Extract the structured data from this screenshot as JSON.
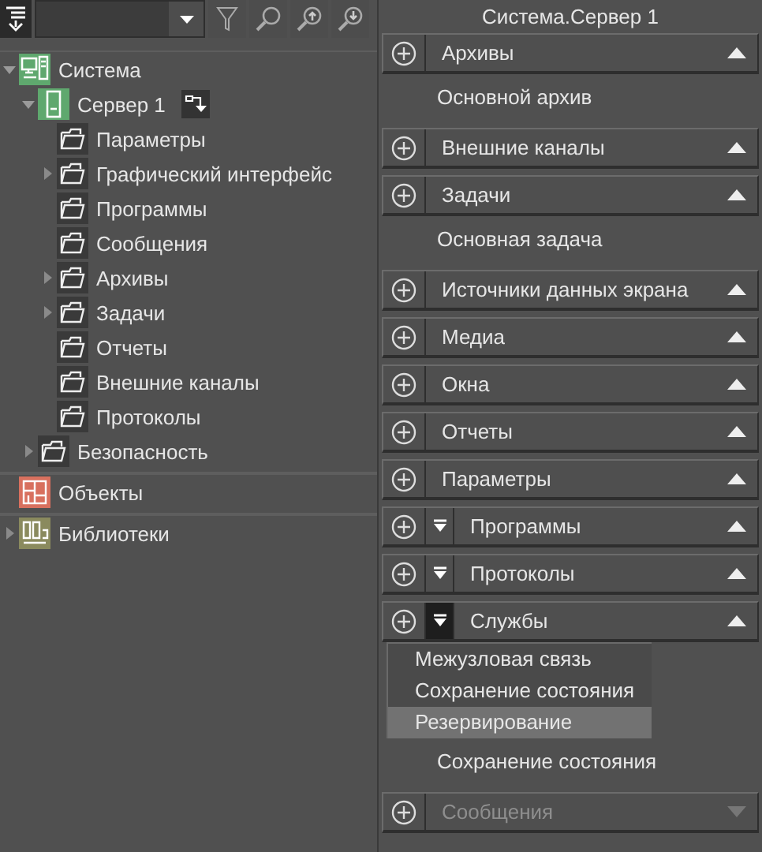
{
  "tree": [
    {
      "label": "Система",
      "kind": "system",
      "expanded": true,
      "children": [
        {
          "label": "Сервер 1",
          "kind": "server",
          "expanded": true,
          "children": [
            {
              "label": "Параметры",
              "kind": "folder"
            },
            {
              "label": "Графический интерфейс",
              "kind": "folder",
              "expanded": false
            },
            {
              "label": "Программы",
              "kind": "folder"
            },
            {
              "label": "Сообщения",
              "kind": "folder"
            },
            {
              "label": "Архивы",
              "kind": "folder",
              "expanded": false
            },
            {
              "label": "Задачи",
              "kind": "folder",
              "expanded": false
            },
            {
              "label": "Отчеты",
              "kind": "folder"
            },
            {
              "label": "Внешние каналы",
              "kind": "folder"
            },
            {
              "label": "Протоколы",
              "kind": "folder"
            }
          ]
        },
        {
          "label": "Безопасность",
          "kind": "folder",
          "expanded": false
        }
      ]
    },
    {
      "label": "Объекты",
      "kind": "objects"
    },
    {
      "label": "Библиотеки",
      "kind": "libraries",
      "expanded": false
    }
  ],
  "panel": {
    "title": "Система.Сервер 1",
    "sections": [
      {
        "title": "Архивы",
        "expanded": true,
        "disabled": false,
        "items": [
          "Основной архив"
        ]
      },
      {
        "title": "Внешние каналы",
        "expanded": true,
        "disabled": false
      },
      {
        "title": "Задачи",
        "expanded": true,
        "disabled": false,
        "items": [
          "Основная задача"
        ]
      },
      {
        "title": "Источники данных экрана",
        "expanded": true,
        "disabled": false
      },
      {
        "title": "Медиа",
        "expanded": true,
        "disabled": false
      },
      {
        "title": "Окна",
        "expanded": true,
        "disabled": false
      },
      {
        "title": "Отчеты",
        "expanded": true,
        "disabled": false
      },
      {
        "title": "Параметры",
        "expanded": true,
        "disabled": false
      },
      {
        "title": "Программы",
        "filter": {
          "active": false
        },
        "expanded": true,
        "disabled": false
      },
      {
        "title": "Протоколы",
        "filter": {
          "active": false
        },
        "expanded": true,
        "disabled": false
      },
      {
        "title": "Службы",
        "filter": {
          "active": true
        },
        "expanded": true,
        "disabled": false,
        "menu": [
          {
            "label": "Межузловая связь",
            "selected": false
          },
          {
            "label": "Сохранение состояния",
            "selected": false
          },
          {
            "label": "Резервирование",
            "selected": true
          }
        ],
        "items": [
          "Сохранение состояния"
        ]
      },
      {
        "title": "Сообщения",
        "expanded": false,
        "disabled": true
      }
    ]
  }
}
